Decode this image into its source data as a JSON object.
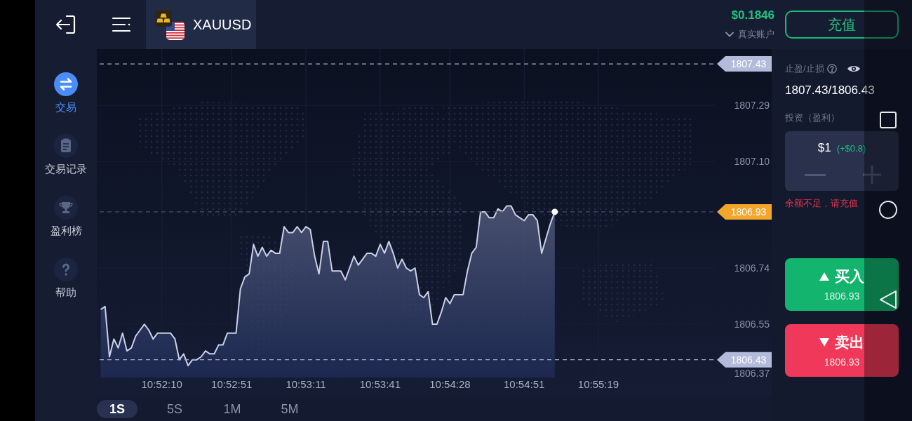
{
  "top_bar": {
    "asset": "XAUUSD",
    "balance": "$0.1846",
    "account": "真实账户",
    "deposit_button": "充值"
  },
  "sidebar": {
    "items": [
      {
        "kind": "trade",
        "label": "交易",
        "selected": true
      },
      {
        "kind": "history",
        "label": "交易记录",
        "selected": false
      },
      {
        "kind": "leaderboard",
        "label": "盈利榜",
        "selected": false
      },
      {
        "kind": "help",
        "label": "帮助",
        "selected": false
      }
    ]
  },
  "chart": {
    "chart_data": {
      "type": "line",
      "categories": [
        null,
        null,
        null,
        null,
        null,
        null,
        null,
        null,
        null,
        null,
        null,
        null,
        null,
        null,
        "10:52:10",
        null,
        null,
        null,
        null,
        null,
        null,
        null,
        null,
        null,
        null,
        null,
        null,
        null,
        null,
        null,
        "10:52:51",
        null,
        null,
        null,
        null,
        null,
        null,
        null,
        null,
        null,
        null,
        null,
        null,
        null,
        null,
        null,
        null,
        "10:53:11",
        null,
        null,
        null,
        null,
        null,
        null,
        null,
        null,
        null,
        null,
        null,
        null,
        null,
        null,
        null,
        null,
        "10:53:41",
        null,
        null,
        null,
        null,
        null,
        null,
        null,
        null,
        null,
        null,
        null,
        null,
        null,
        null,
        null,
        "10:54:28",
        null,
        null,
        null,
        null,
        null,
        null,
        null,
        null,
        null,
        null,
        null,
        null,
        null,
        null,
        null,
        null,
        "10:54:51",
        null,
        null,
        null,
        null,
        null,
        null,
        null,
        null,
        null,
        null,
        null,
        null,
        null,
        null,
        null,
        null,
        "10:55:19"
      ],
      "values": [
        1806.6,
        1806.61,
        1806.44,
        1806.5,
        1806.47,
        1806.52,
        1806.46,
        1806.47,
        1806.51,
        1806.53,
        1806.55,
        1806.53,
        1806.5,
        1806.52,
        1806.52,
        1806.52,
        1806.52,
        1806.5,
        1806.43,
        1806.45,
        1806.41,
        1806.43,
        1806.43,
        1806.44,
        1806.46,
        1806.45,
        1806.45,
        1806.48,
        1806.48,
        1806.52,
        1806.52,
        1806.52,
        1806.67,
        1806.71,
        1806.72,
        1806.82,
        1806.78,
        1806.81,
        1806.78,
        1806.8,
        1806.79,
        1806.79,
        1806.88,
        1806.86,
        1806.86,
        1806.88,
        1806.86,
        1806.88,
        1806.87,
        1806.78,
        1806.72,
        1806.83,
        1806.83,
        1806.73,
        1806.73,
        1806.73,
        1806.7,
        1806.74,
        1806.78,
        1806.75,
        1806.77,
        1806.79,
        1806.79,
        1806.78,
        1806.82,
        1806.79,
        1806.83,
        1806.79,
        1806.74,
        1806.77,
        1806.74,
        1806.73,
        1806.74,
        1806.65,
        1806.64,
        1806.66,
        1806.55,
        1806.55,
        1806.59,
        1806.64,
        1806.62,
        1806.65,
        1806.65,
        1806.65,
        1806.73,
        1806.79,
        1806.81,
        1806.93,
        1806.93,
        1806.91,
        1806.91,
        1806.94,
        1806.93,
        1806.95,
        1806.95,
        1806.92,
        1806.91,
        1806.9,
        1806.92,
        1806.92,
        1806.9,
        1806.79,
        1806.84,
        1806.89,
        1806.93,
        null,
        null,
        null,
        null,
        null,
        null,
        null,
        null,
        null,
        null
      ],
      "ylim": [
        1806.37,
        1807.48
      ],
      "yticks": [
        {
          "value": 1807.29,
          "label": "1807.29"
        },
        {
          "value": 1807.1,
          "label": "1807.10"
        },
        {
          "value": 1806.74,
          "label": "1806.74"
        },
        {
          "value": 1806.55,
          "label": "1806.55"
        },
        {
          "value": 1806.37,
          "label": "1806.37"
        }
      ],
      "grid": true,
      "ref_lines": [
        {
          "axis": "y",
          "value": 1807.43,
          "label": "1807.43",
          "color": "#a4abc4"
        },
        {
          "axis": "y",
          "value": 1806.93,
          "label": "1806.93",
          "color": "#464d69"
        },
        {
          "axis": "y",
          "value": 1806.43,
          "label": "1806.43",
          "color": "#a4abc4"
        }
      ]
    }
  },
  "timeframes": [
    {
      "label": "1S",
      "selected": true
    },
    {
      "label": "5S",
      "selected": false
    },
    {
      "label": "1M",
      "selected": false
    },
    {
      "label": "5M",
      "selected": false
    }
  ],
  "order_panel": {
    "tp_sl_label": "止盈/止损",
    "tp_sl_value": "1807.43/1806.43",
    "investment_label": "投资（盈利）",
    "amount": "$1",
    "profit": "(+$0.8)",
    "warning": "余额不足，请充值",
    "trade_buttons": [
      {
        "kind": "buy",
        "label": "买入",
        "price": "1806.93"
      },
      {
        "kind": "sell",
        "label": "卖出",
        "price": "1806.93"
      }
    ]
  }
}
